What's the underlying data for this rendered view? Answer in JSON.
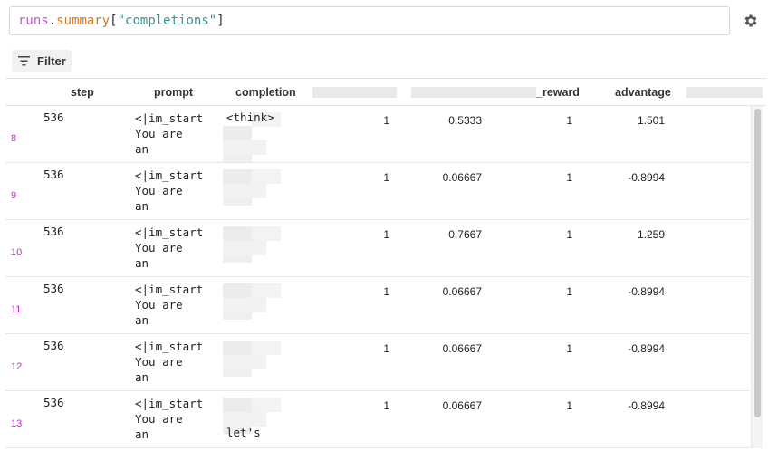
{
  "query": {
    "runs": "runs",
    "dot": ".",
    "summary": "summary",
    "open": "[",
    "key": "\"completions\"",
    "close": "]"
  },
  "toolbar": {
    "filter_label": "Filter"
  },
  "table": {
    "headers": {
      "step": "step",
      "prompt": "prompt",
      "completion": "completion",
      "reward_suffix": "_reward",
      "advantage": "advantage"
    },
    "rows": [
      {
        "index": "8",
        "step": "536",
        "prompt": "<|im_start\nYou are\nan",
        "completion_text": "<think>",
        "col4": "1",
        "col5": "0.5333",
        "reward": "1",
        "advantage": "1.501"
      },
      {
        "index": "9",
        "step": "536",
        "prompt": "<|im_start\nYou are\nan",
        "completion_text": "",
        "col4": "1",
        "col5": "0.06667",
        "reward": "1",
        "advantage": "-0.8994"
      },
      {
        "index": "10",
        "step": "536",
        "prompt": "<|im_start\nYou are\nan",
        "completion_text": "",
        "col4": "1",
        "col5": "0.7667",
        "reward": "1",
        "advantage": "1.259"
      },
      {
        "index": "11",
        "step": "536",
        "prompt": "<|im_start\nYou are\nan",
        "completion_text": "",
        "col4": "1",
        "col5": "0.06667",
        "reward": "1",
        "advantage": "-0.8994"
      },
      {
        "index": "12",
        "step": "536",
        "prompt": "<|im_start\nYou are\nan",
        "completion_text": "",
        "col4": "1",
        "col5": "0.06667",
        "reward": "1",
        "advantage": "-0.8994"
      },
      {
        "index": "13",
        "step": "536",
        "prompt": "<|im_start\nYou are\nan",
        "completion_text": "let's",
        "col4": "1",
        "col5": "0.06667",
        "reward": "1",
        "advantage": "-0.8994"
      }
    ]
  },
  "colors": {
    "index": "#c02bc6",
    "runs": "#b85ec4",
    "summary": "#cf7a2b",
    "string": "#3f8f8f"
  },
  "icons": {
    "settings": "gear-icon",
    "filter": "filter-lines-icon"
  }
}
